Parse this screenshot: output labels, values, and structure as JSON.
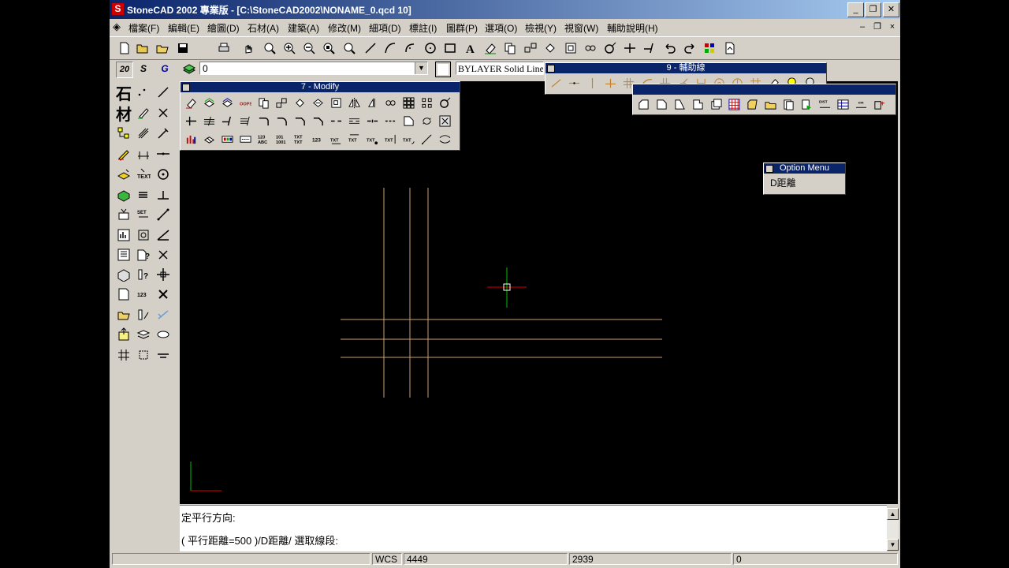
{
  "window": {
    "title": "StoneCAD 2002 專業版 - [C:\\StoneCAD2002\\NONAME_0.qcd 10]",
    "app_icon_letter": "S",
    "min_label": "_",
    "max_label": "❐",
    "close_label": "✕"
  },
  "menu": {
    "items": [
      "檔案(F)",
      "編輯(E)",
      "繪圖(D)",
      "石材(A)",
      "建築(A)",
      "修改(M)",
      "細項(D)",
      "標註(I)",
      "圖群(P)",
      "選項(O)",
      "檢視(Y)",
      "視窗(W)",
      "輔助說明(H)"
    ],
    "mdi_min": "–",
    "mdi_restore": "❐",
    "mdi_close": "×"
  },
  "toolbar": {
    "layer_value": "0",
    "linetype_value": "BYLAYER Solid Line",
    "combo_arrow": "▼",
    "snap_buttons": [
      "20",
      "S",
      "G"
    ]
  },
  "left_tools": {
    "big_glyphs": [
      "石",
      "材"
    ]
  },
  "modify_toolbar": {
    "title": "7 - Modify"
  },
  "aux_toolbar": {
    "title": "9 - 輔助線"
  },
  "option_menu": {
    "title": "Option Menu",
    "items": [
      "D距離"
    ]
  },
  "command": {
    "line1": "定平行方向:",
    "line2": "( 平行距離=500 )/D距離/ 選取線段:"
  },
  "statusbar": {
    "coord_system": "WCS",
    "x": "4449",
    "y": "2939",
    "z": "0"
  },
  "colors": {
    "title_start": "#0a246a",
    "title_end": "#a6caf0",
    "face": "#d4d0c8",
    "guide_line": "#c8a070",
    "cursor_red": "#e00000",
    "cursor_green": "#00c000"
  }
}
